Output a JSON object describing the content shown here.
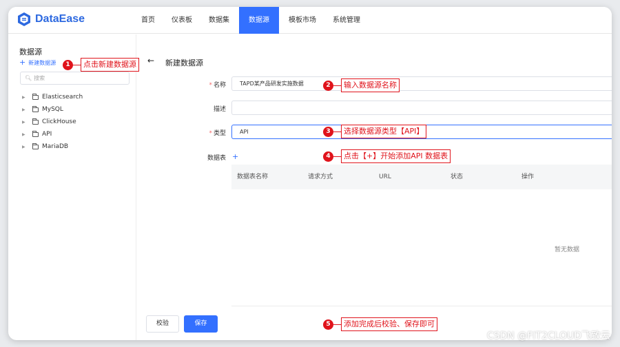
{
  "app": {
    "logo_text": "DataEase"
  },
  "nav": {
    "items": [
      "首页",
      "仪表板",
      "数据集",
      "数据源",
      "模板市场",
      "系统管理"
    ],
    "active": "数据源"
  },
  "sidebar": {
    "title": "数据源",
    "new_label": "新建数据源",
    "search_placeholder": "搜索",
    "tree": [
      "Elasticsearch",
      "MySQL",
      "ClickHouse",
      "API",
      "MariaDB"
    ]
  },
  "form": {
    "title": "新建数据源",
    "name_label": "名称",
    "name_value": "TAPD某产品研发实施数据",
    "desc_label": "描述",
    "desc_value": "",
    "type_label": "类型",
    "type_value": "API",
    "tables_label": "数据表",
    "table_columns": [
      "数据表名称",
      "请求方式",
      "URL",
      "状态",
      "操作"
    ],
    "empty_text": "暂无数据",
    "verify_button": "校验",
    "save_button": "保存"
  },
  "annotations": [
    {
      "num": "1",
      "text": "点击新建数据源"
    },
    {
      "num": "2",
      "text": "输入数据源名称"
    },
    {
      "num": "3",
      "text": "选择数据源类型【API】"
    },
    {
      "num": "4",
      "text": "点击【+】开始添加API 数据表"
    },
    {
      "num": "5",
      "text": "添加完成后校验、保存即可"
    }
  ],
  "watermark": "CSDN @FIT2CLOUD飞致云",
  "colors": {
    "accent": "#3370ff",
    "brand": "#2d69e0",
    "annotation": "#e0131b",
    "required": "#f56c6c"
  }
}
